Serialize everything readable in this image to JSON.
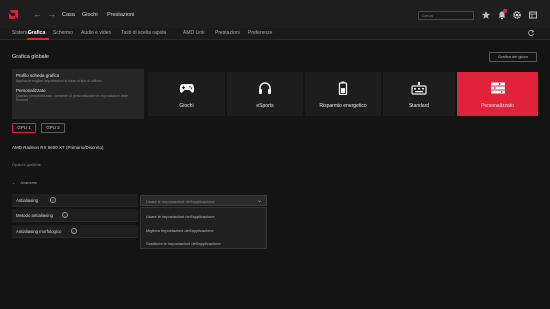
{
  "topbar": {
    "nav": [
      "Casa",
      "Giochi",
      "Prestazioni"
    ],
    "search_placeholder": "Cerca"
  },
  "tabs": [
    "Sistema",
    "Grafica",
    "Schermo",
    "Audio e video",
    "Tasti di scelta rapida",
    "AMD Link",
    "Prestazioni",
    "Preferenze"
  ],
  "active_tab": "Grafica",
  "header": {
    "title": "Grafica globale",
    "button": "Grafica del gioco"
  },
  "profile_panel": {
    "title1": "Profilo scheda grafica",
    "desc1": "Applica le migliori impostazioni in base al tipo di utilizzo",
    "title2": "Personalizzato",
    "desc2": "Quando personalizzato, consente di personalizzare le impostazioni delle funzioni"
  },
  "profiles": [
    {
      "label": "Giochi",
      "icon": "gamepad-icon",
      "active": false
    },
    {
      "label": "eSports",
      "icon": "headset-icon",
      "active": false
    },
    {
      "label": "Risparmio energetico",
      "icon": "battery-icon",
      "active": false
    },
    {
      "label": "Standard",
      "icon": "keyboard-icon",
      "active": false
    },
    {
      "label": "Personalizzato",
      "icon": "sliders-icon",
      "active": true
    }
  ],
  "gpu": [
    "GPU 1",
    "GPU 2"
  ],
  "device": "AMD Radeon RX 6600 XT (Primario/Discreto)",
  "options_label": "Opzioni grafiche",
  "advanced": "Avanzate",
  "settings": [
    {
      "label": "Antialiasing"
    },
    {
      "label": "Metodo antialiasing"
    },
    {
      "label": "Antialiasing morfologico"
    }
  ],
  "dropdown": {
    "value": "Usare le impostazioni dell'applicazione",
    "options": [
      "Usare le impostazioni dell'applicazione",
      "Migliora impostazioni dell'applicazione",
      "Sostituire le impostazioni dell'applicazione"
    ]
  },
  "colors": {
    "accent": "#e2223a",
    "background": "#141414",
    "panel": "#262626"
  }
}
